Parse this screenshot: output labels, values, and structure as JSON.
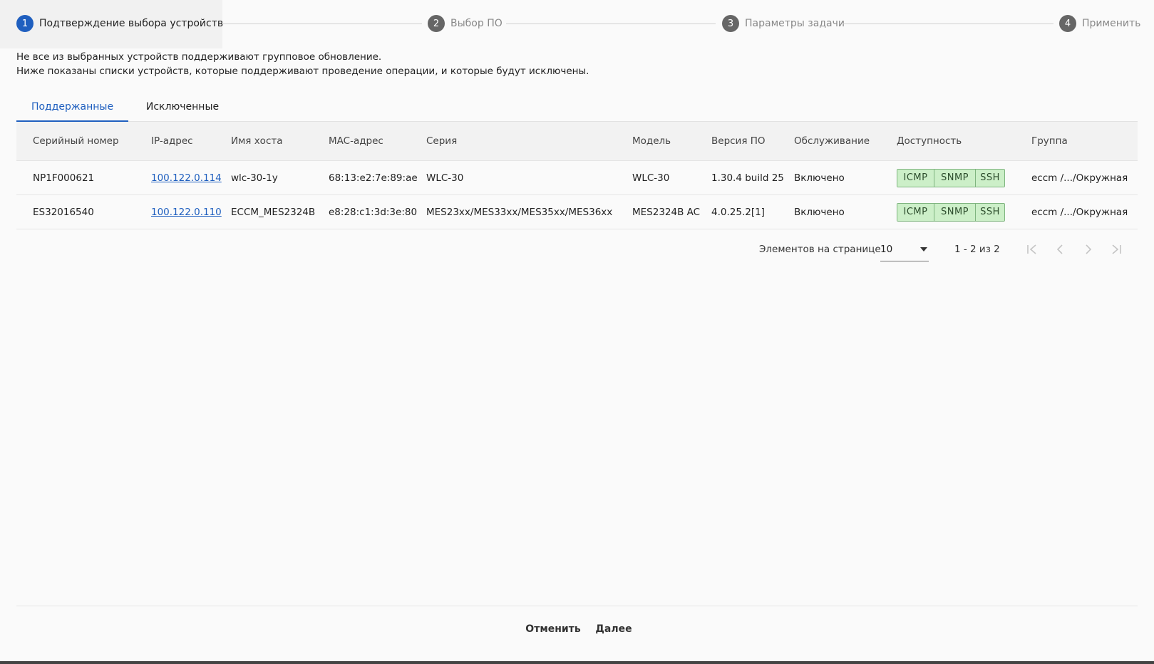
{
  "stepper": {
    "steps": [
      {
        "number": "1",
        "label": "Подтверждение выбора устройств"
      },
      {
        "number": "2",
        "label": "Выбор ПО"
      },
      {
        "number": "3",
        "label": "Параметры задачи"
      },
      {
        "number": "4",
        "label": "Применить"
      }
    ],
    "active_step": 1
  },
  "info": {
    "line1": "Не все из выбранных устройств поддерживают групповое обновление.",
    "line2": "Ниже показаны списки устройств, которые поддерживают проведение операции, и которые будут исключены."
  },
  "tabs": [
    {
      "label": "Поддержанные"
    },
    {
      "label": "Исключенные"
    }
  ],
  "table": {
    "headers": {
      "serial": "Серийный номер",
      "ip": "IP-адрес",
      "hostname": "Имя хоста",
      "mac": "MAC-адрес",
      "series": "Серия",
      "model": "Модель",
      "firmware": "Версия ПО",
      "service": "Обслуживание",
      "availability": "Доступность",
      "group": "Группа"
    },
    "rows": [
      {
        "serial": "NP1F000621",
        "ip": "100.122.0.114",
        "hostname": "wlc-30-1y",
        "mac": "68:13:e2:7e:89:ae",
        "series": "WLC-30",
        "model": "WLC-30",
        "firmware": "1.30.4 build 25",
        "service": "Включено",
        "availability": [
          "ICMP",
          "SNMP",
          "SSH"
        ],
        "group": "eccm /.../Окружная"
      },
      {
        "serial": "ES32016540",
        "ip": "100.122.0.110",
        "hostname": "ECCM_MES2324B",
        "mac": "e8:28:c1:3d:3e:80",
        "series": "MES23xx/MES33xx/MES35xx/MES36xx",
        "model": "MES2324B AC",
        "firmware": "4.0.25.2[1]",
        "service": "Включено",
        "availability": [
          "ICMP",
          "SNMP",
          "SSH"
        ],
        "group": "eccm /.../Окружная"
      }
    ]
  },
  "pagination": {
    "label": "Элементов на странице",
    "page_size": "10",
    "range": "1 - 2 из 2"
  },
  "footer": {
    "cancel": "Отменить",
    "next": "Далее"
  },
  "colors": {
    "accent": "#1f5fbf",
    "badge_bg": "#ccefc8",
    "badge_border": "#7fb47f"
  }
}
